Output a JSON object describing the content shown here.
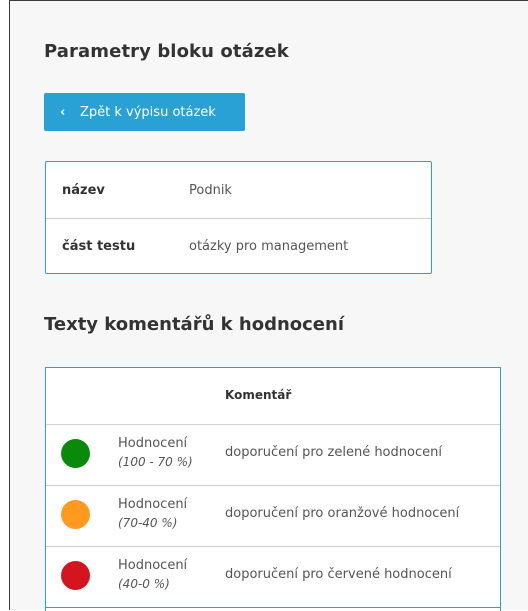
{
  "page": {
    "title": "Parametry bloku otázek",
    "back_button": "Zpět k výpisu otázek"
  },
  "info": {
    "rows": [
      {
        "key": "název",
        "value": "Podnik"
      },
      {
        "key": "část testu",
        "value": "otázky pro management"
      }
    ]
  },
  "comments": {
    "section_title": "Texty komentářů k hodnocení",
    "column_header": "Komentář",
    "rows": [
      {
        "level": "Hodnocení",
        "range": "(100 - 70 %)",
        "color": "#0a8a0a",
        "text": "doporučení pro zelené hodnocení"
      },
      {
        "level": "Hodnocení",
        "range": "(70-40 %)",
        "color": "#ff9a1f",
        "text": "doporučení pro oranžové hodnocení"
      },
      {
        "level": "Hodnocení",
        "range": "(40-0 %)",
        "color": "#d4141e",
        "text": "doporučení pro červené hodnocení"
      }
    ]
  }
}
